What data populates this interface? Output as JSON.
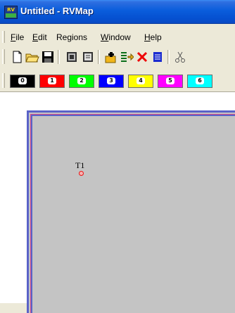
{
  "window": {
    "title": "Untitled - RVMap",
    "icon_text": "RV"
  },
  "menu": {
    "items": [
      {
        "label": "File",
        "mnemonic": "F"
      },
      {
        "label": "Edit",
        "mnemonic": "E"
      },
      {
        "label": "Regions",
        "mnemonic": ""
      },
      {
        "label": "Window",
        "mnemonic": "W"
      },
      {
        "label": "Help",
        "mnemonic": "H"
      }
    ]
  },
  "toolbar": {
    "buttons": [
      {
        "name": "new-icon"
      },
      {
        "name": "open-folder-icon"
      },
      {
        "name": "save-icon"
      },
      {
        "name": "view-grid-icon"
      },
      {
        "name": "view-list-icon"
      },
      {
        "name": "add-target-icon"
      },
      {
        "name": "insert-icon"
      },
      {
        "name": "delete-icon"
      },
      {
        "name": "table-icon"
      },
      {
        "name": "cut-icon"
      }
    ]
  },
  "regions": [
    {
      "badge": "0",
      "color": "#000000"
    },
    {
      "badge": "1",
      "color": "#ff0000"
    },
    {
      "badge": "2",
      "color": "#00ff00"
    },
    {
      "badge": "3",
      "color": "#0000ff"
    },
    {
      "badge": "4",
      "color": "#ffff00"
    },
    {
      "badge": "5",
      "color": "#ff00ff"
    },
    {
      "badge": "6",
      "color": "#00ffff"
    }
  ],
  "map": {
    "frame_color": "#5a63c8",
    "background": "#c4c4c4",
    "targets": [
      {
        "label": "T1",
        "color": "#ee1111"
      }
    ]
  }
}
